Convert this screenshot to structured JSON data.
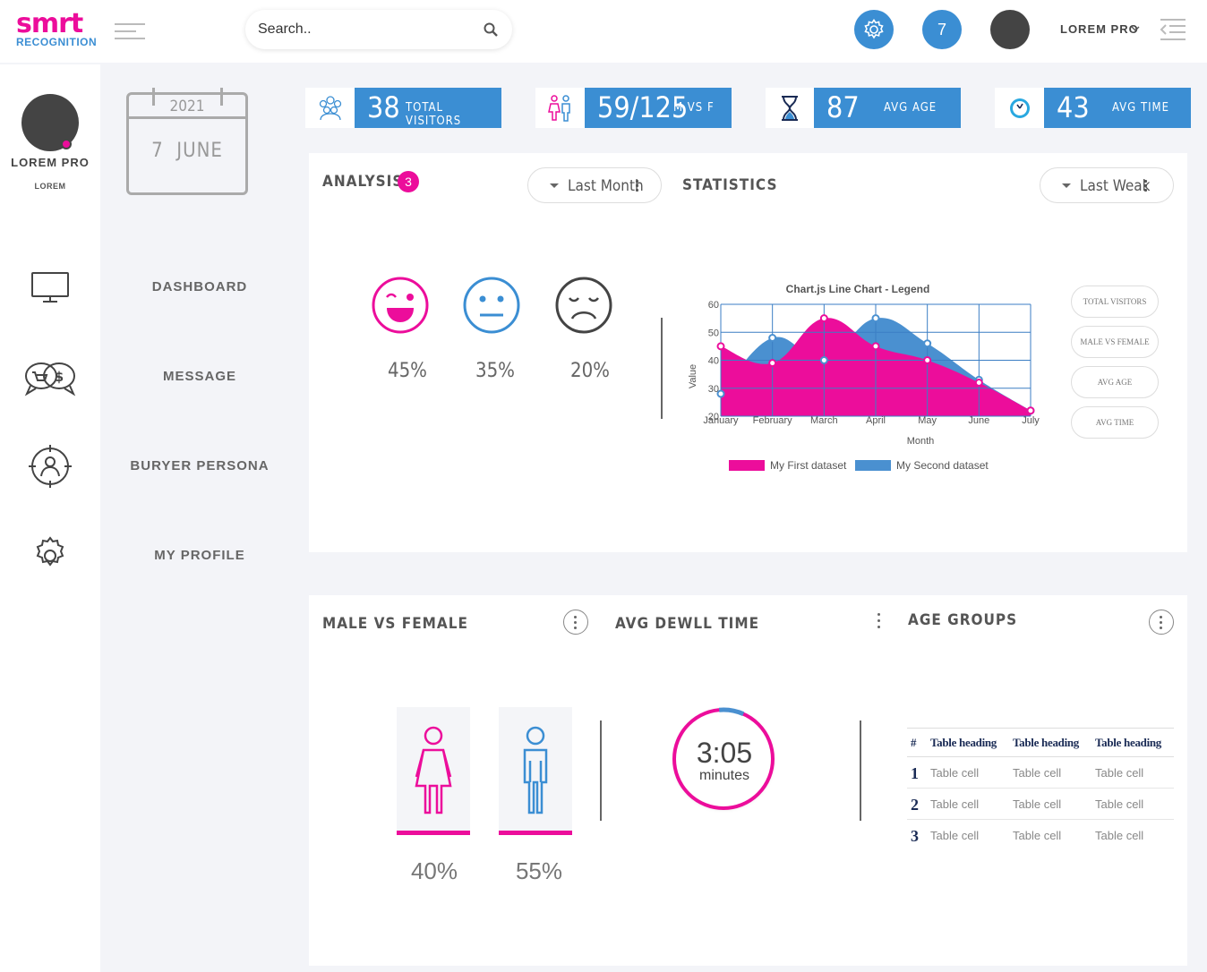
{
  "brand": {
    "logo_top": "smrt",
    "logo_bottom": "RECOGNITION",
    "pink": "#ec0d9b",
    "blue": "#3b8ed3"
  },
  "header": {
    "search_placeholder": "Search..",
    "notification_count": "7",
    "user_name": "LOREM PRO"
  },
  "sidebar": {
    "name": "LOREM PRO",
    "role": "LOREM",
    "icons": [
      "monitor-icon",
      "chat-shop-icon",
      "target-person-icon",
      "gear-icon"
    ]
  },
  "calendar": {
    "year": "2021",
    "day": "7  JUNE"
  },
  "nav": [
    "DASHBOARD",
    "MESSAGE",
    "BURYER PERSONA",
    "MY PROFILE"
  ],
  "stats": [
    {
      "value": "38",
      "label": "TOTAL VISITORS",
      "icon": "people-icon"
    },
    {
      "value": "59/125",
      "label": "M VS F",
      "icon": "gender-icon"
    },
    {
      "value": "87",
      "label": "AVG AGE",
      "icon": "hourglass-icon"
    },
    {
      "value": "43",
      "label": "AVG TIME",
      "icon": "clock-icon"
    }
  ],
  "analysis": {
    "title": "ANALYSIS",
    "badge": "3",
    "filter": "Last Month",
    "moods": [
      {
        "icon": "happy-face-icon",
        "percent": "45%"
      },
      {
        "icon": "neutral-face-icon",
        "percent": "35%"
      },
      {
        "icon": "sad-face-icon",
        "percent": "20%"
      }
    ]
  },
  "statistics": {
    "title": "STATISTICS",
    "filter": "Last Weak",
    "legend_buttons": [
      "TOTAL VISITORS",
      "MALE VS FEMALE",
      "AVG AGE",
      "AVG TIME"
    ]
  },
  "chart_data": {
    "type": "area",
    "title": "Chart.js Line Chart - Legend",
    "xlabel": "Month",
    "ylabel": "Value",
    "categories": [
      "January",
      "February",
      "March",
      "April",
      "May",
      "June",
      "July"
    ],
    "ylim": [
      20,
      60
    ],
    "yticks": [
      20,
      30,
      40,
      50,
      60
    ],
    "grid": true,
    "legend_position": "bottom",
    "series": [
      {
        "name": "My First dataset",
        "color": "#ec0d9b",
        "values": [
          45,
          39,
          55,
          45,
          40,
          32,
          22
        ]
      },
      {
        "name": "My Second dataset",
        "color": "#4a90d0",
        "values": [
          28,
          48,
          40,
          55,
          46,
          33,
          22
        ]
      }
    ]
  },
  "male_female": {
    "title": "MALE VS FEMALE",
    "female_percent": "40%",
    "male_percent": "55%"
  },
  "dwell": {
    "title": "AVG DEWLL TIME",
    "time": "3:05",
    "unit": "minutes",
    "progress": 0.08
  },
  "age_groups": {
    "title": "AGE GROUPS",
    "headers": [
      "#",
      "Table heading",
      "Table heading",
      "Table heading"
    ],
    "rows": [
      [
        "1",
        "Table cell",
        "Table cell",
        "Table cell"
      ],
      [
        "2",
        "Table cell",
        "Table cell",
        "Table cell"
      ],
      [
        "3",
        "Table cell",
        "Table cell",
        "Table cell"
      ]
    ]
  }
}
